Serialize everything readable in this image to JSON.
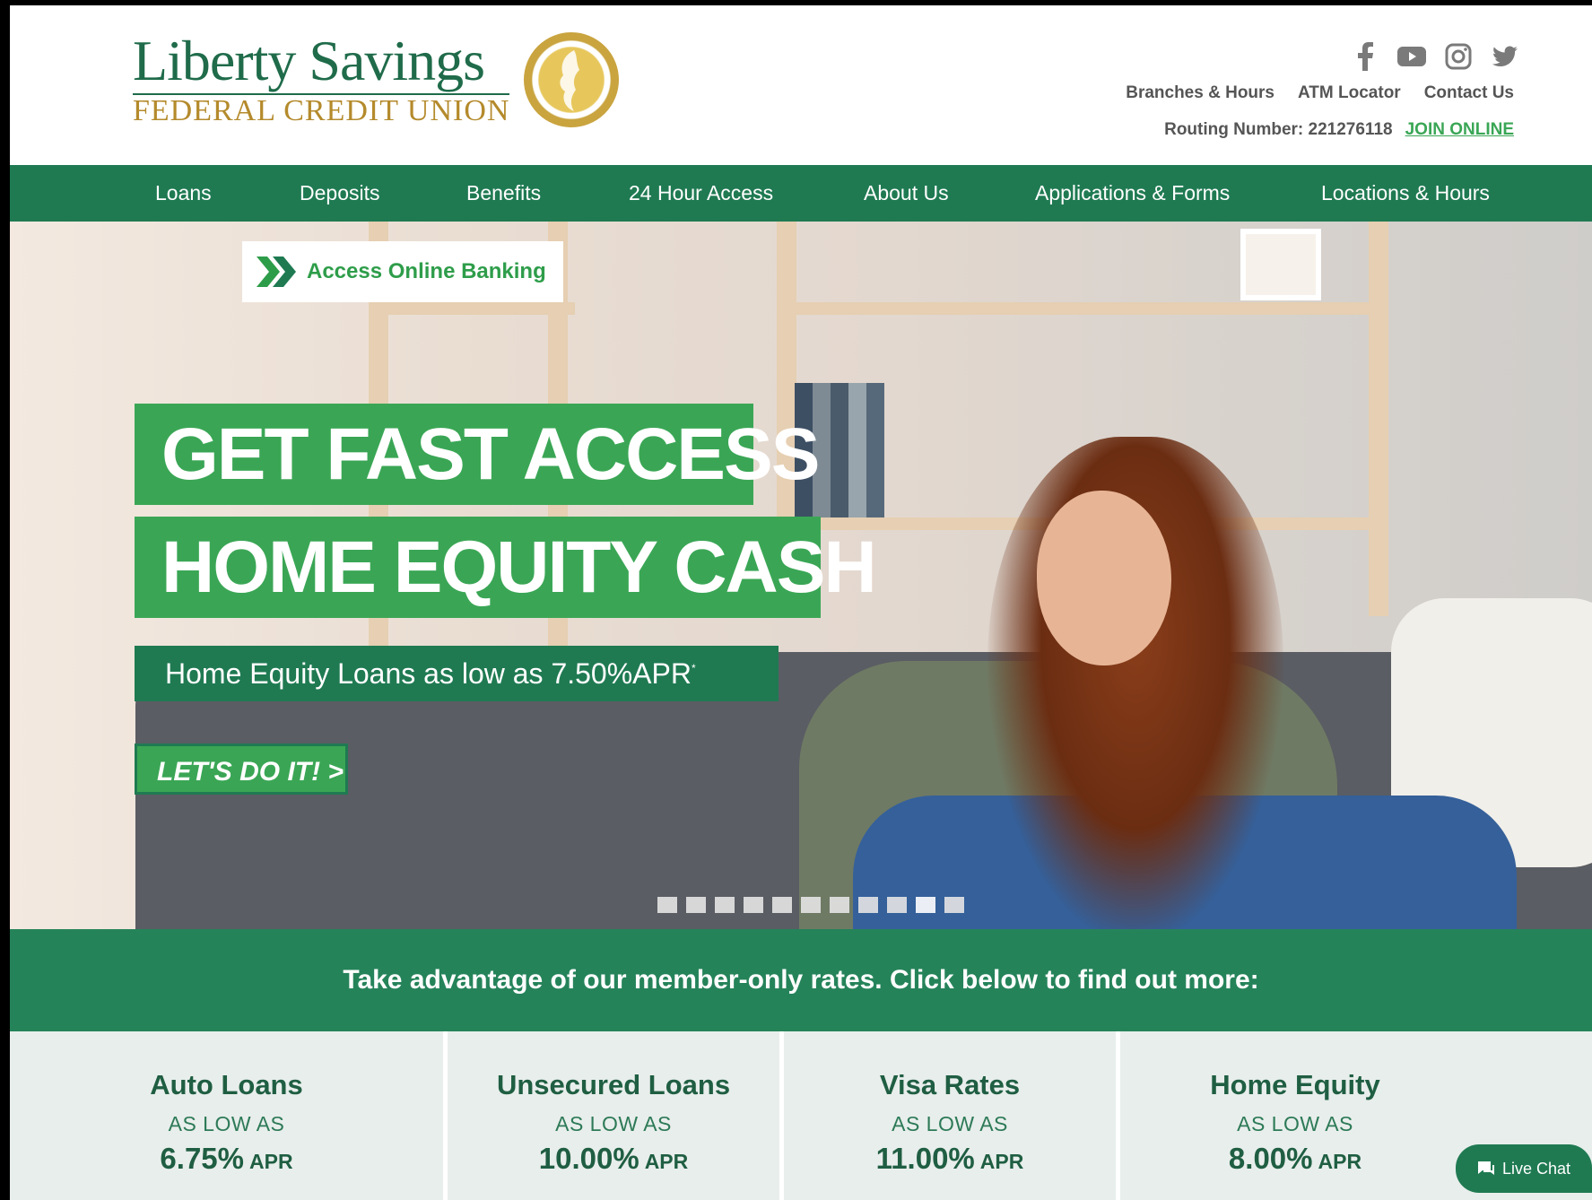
{
  "brand": {
    "name_line1": "Liberty Savings",
    "name_line2": "FEDERAL CREDIT UNION"
  },
  "social": [
    "facebook-icon",
    "youtube-icon",
    "instagram-icon",
    "twitter-icon"
  ],
  "top_links": {
    "branches": "Branches & Hours",
    "atm": "ATM Locator",
    "contact": "Contact Us"
  },
  "routing": {
    "label": "Routing Number: 221276118",
    "join": "JOIN ONLINE"
  },
  "nav": {
    "loans": "Loans",
    "deposits": "Deposits",
    "benefits": "Benefits",
    "access": "24 Hour Access",
    "about": "About Us",
    "applications": "Applications & Forms",
    "locations": "Locations & Hours"
  },
  "hero": {
    "online_banking": "Access Online Banking",
    "headline1": "GET FAST ACCESS",
    "headline2": "HOME EQUITY CASH",
    "subline": "Home Equity Loans as low as 7.50%APR",
    "subline_mark": "*",
    "cta": "LET'S DO IT! >",
    "slide_count": 11,
    "active_slide": 10
  },
  "promo_band": "Take advantage of our member-only rates. Click below to find out more:",
  "rates": [
    {
      "title": "Auto Loans",
      "low": "AS LOW AS",
      "value": "6.75%",
      "unit": "APR"
    },
    {
      "title": "Unsecured Loans",
      "low": "AS LOW AS",
      "value": "10.00%",
      "unit": "APR"
    },
    {
      "title": "Visa Rates",
      "low": "AS LOW AS",
      "value": "11.00%",
      "unit": "APR"
    },
    {
      "title": "Home Equity",
      "low": "AS LOW AS",
      "value": "8.00%",
      "unit": "APR"
    }
  ],
  "chat": "Live Chat",
  "colors": {
    "primary_green": "#1f7a52",
    "accent_green": "#3aa655",
    "gold": "#c9a43f"
  }
}
